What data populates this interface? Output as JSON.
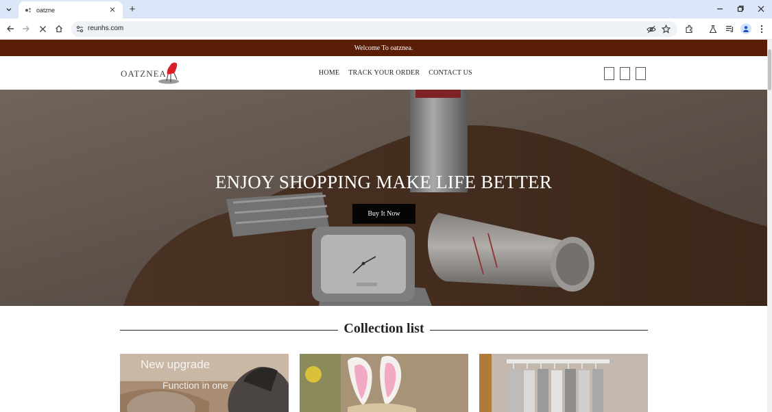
{
  "browser": {
    "tab_title": "oatzne",
    "url": "reunhs.com",
    "colors": {
      "tabbar": "#dbe6f8",
      "omnibox": "#eef1f6"
    }
  },
  "page": {
    "announcement": "Welcome To oatznea.",
    "logo_text": "OATZNEA",
    "nav": [
      "HOME",
      "TRACK YOUR ORDER",
      "CONTACT US"
    ],
    "hero": {
      "title": "ENJOY SHOPPING MAKE LIFE BETTER",
      "button": "Buy It Now"
    },
    "collection_title": "Collection list",
    "cards": [
      {
        "line1": "New upgrade",
        "line2": "Function in one"
      },
      {
        "line1": "",
        "line2": ""
      },
      {
        "line1": "",
        "line2": ""
      }
    ],
    "colors": {
      "announcement_bg": "#5a1e07",
      "button_bg": "#050505",
      "logo_chair": "#d81f26"
    }
  }
}
